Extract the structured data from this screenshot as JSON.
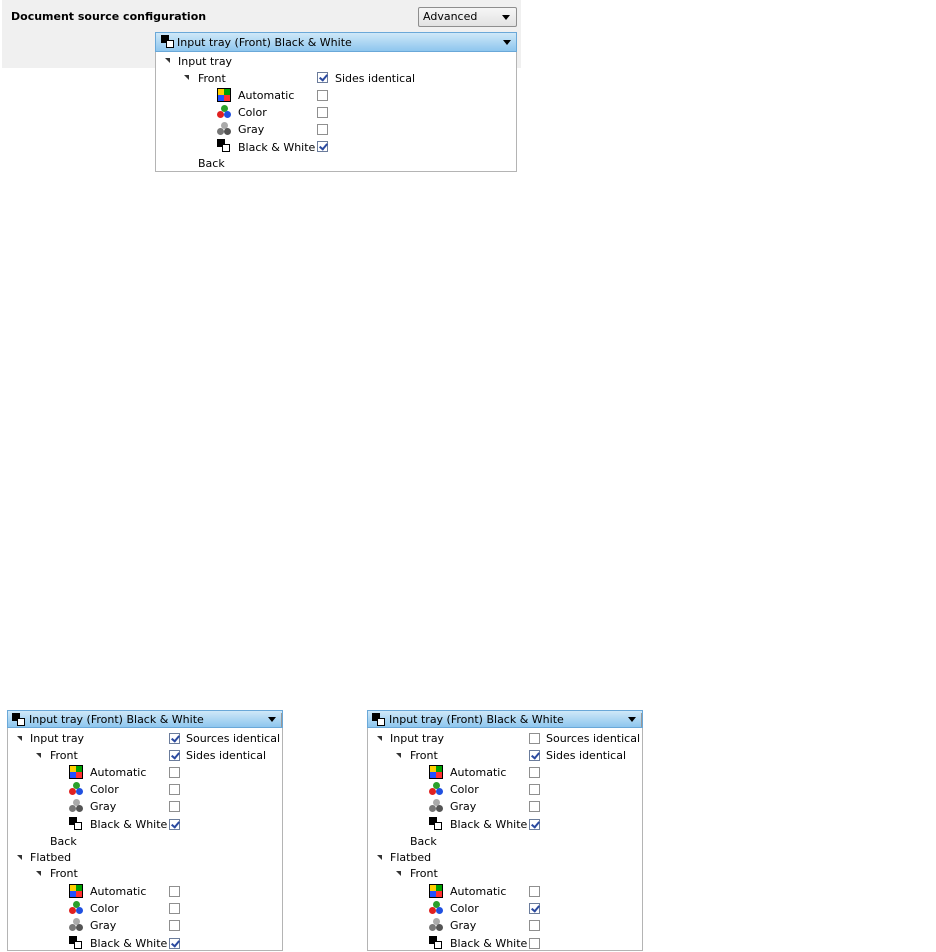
{
  "top": {
    "title": "Document source configuration",
    "mode_value": "Advanced",
    "combo_value": "Input tray (Front) Black & White",
    "tree": {
      "input_tray": "Input tray",
      "front": "Front",
      "sides_identical": "Sides identical",
      "automatic": "Automatic",
      "color": "Color",
      "gray": "Gray",
      "bw": "Black & White",
      "back": "Back",
      "checks": {
        "sides_identical": true,
        "automatic": false,
        "color": false,
        "gray": false,
        "bw": true
      }
    }
  },
  "left": {
    "combo_value": "Input tray (Front) Black & White",
    "input_tray": "Input tray",
    "sources_identical": "Sources identical",
    "front": "Front",
    "sides_identical": "Sides identical",
    "automatic": "Automatic",
    "color": "Color",
    "gray": "Gray",
    "bw": "Black & White",
    "back": "Back",
    "flatbed": "Flatbed",
    "flatbed_front": "Front",
    "flatbed_automatic": "Automatic",
    "flatbed_color": "Color",
    "flatbed_gray": "Gray",
    "flatbed_bw": "Black & White",
    "checks": {
      "sources_identical": true,
      "sides_identical": true,
      "automatic": false,
      "color": false,
      "gray": false,
      "bw": true,
      "fb_automatic": false,
      "fb_color": false,
      "fb_gray": false,
      "fb_bw": true
    }
  },
  "right": {
    "combo_value": "Input tray (Front) Black & White",
    "input_tray": "Input tray",
    "sources_identical": "Sources identical",
    "front": "Front",
    "sides_identical": "Sides identical",
    "automatic": "Automatic",
    "color": "Color",
    "gray": "Gray",
    "bw": "Black & White",
    "back": "Back",
    "flatbed": "Flatbed",
    "flatbed_front": "Front",
    "flatbed_automatic": "Automatic",
    "flatbed_color": "Color",
    "flatbed_gray": "Gray",
    "flatbed_bw": "Black & White",
    "checks": {
      "sources_identical": false,
      "sides_identical": true,
      "automatic": false,
      "color": false,
      "gray": false,
      "bw": true,
      "fb_automatic": false,
      "fb_color": true,
      "fb_gray": false,
      "fb_bw": false
    }
  }
}
